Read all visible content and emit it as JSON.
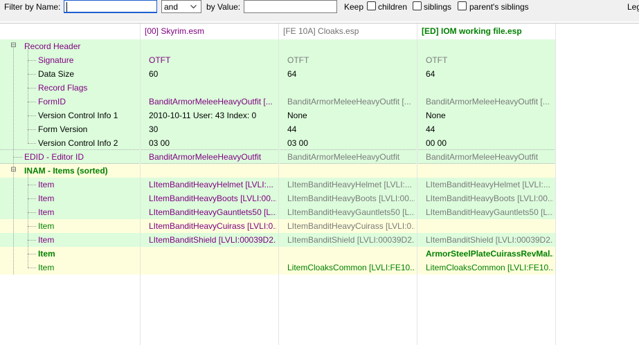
{
  "filter": {
    "by_name_label": "Filter by Name:",
    "name_value": "",
    "operator": "and",
    "by_value_label": "by Value:",
    "value_value": "",
    "keep_label": "Keep",
    "children_label": "children",
    "siblings_label": "siblings",
    "parents_siblings_label": "parent's siblings",
    "legend_partial": "Leg"
  },
  "columns": [
    "[00] Skyrim.esm",
    "[FE 10A] Cloaks.esp",
    "[ED] IOM working file.esp"
  ],
  "rows": [
    {
      "label": "Record Header",
      "values": [
        "",
        "",
        ""
      ]
    },
    {
      "label": "Signature",
      "values": [
        "OTFT",
        "OTFT",
        "OTFT"
      ]
    },
    {
      "label": "Data Size",
      "values": [
        "60",
        "64",
        "64"
      ]
    },
    {
      "label": "Record Flags",
      "values": [
        "",
        "",
        ""
      ]
    },
    {
      "label": "FormID",
      "values": [
        "BanditArmorMeleeHeavyOutfit [...",
        "BanditArmorMeleeHeavyOutfit [...",
        "BanditArmorMeleeHeavyOutfit [..."
      ]
    },
    {
      "label": "Version Control Info 1",
      "values": [
        "2010-10-11 User: 43 Index: 0",
        "None",
        "None"
      ]
    },
    {
      "label": "Form Version",
      "values": [
        "30",
        "44",
        "44"
      ]
    },
    {
      "label": "Version Control Info 2",
      "values": [
        "03 00",
        "03 00",
        "00 00"
      ]
    },
    {
      "label": "EDID - Editor ID",
      "values": [
        "BanditArmorMeleeHeavyOutfit",
        "BanditArmorMeleeHeavyOutfit",
        "BanditArmorMeleeHeavyOutfit"
      ]
    },
    {
      "label": "INAM - Items (sorted)",
      "values": [
        "",
        "",
        ""
      ]
    },
    {
      "label": "Item",
      "values": [
        "LItemBanditHeavyHelmet [LVLI:...",
        "LItemBanditHeavyHelmet [LVLI:...",
        "LItemBanditHeavyHelmet [LVLI:..."
      ]
    },
    {
      "label": "Item",
      "values": [
        "LItemBanditHeavyBoots [LVLI:00...",
        "LItemBanditHeavyBoots [LVLI:00...",
        "LItemBanditHeavyBoots [LVLI:00..."
      ]
    },
    {
      "label": "Item",
      "values": [
        "LItemBanditHeavyGauntlets50 [L...",
        "LItemBanditHeavyGauntlets50 [L...",
        "LItemBanditHeavyGauntlets50 [L..."
      ]
    },
    {
      "label": "Item",
      "values": [
        "LItemBanditHeavyCuirass [LVLI:0...",
        "LItemBanditHeavyCuirass [LVLI:0...",
        ""
      ]
    },
    {
      "label": "Item",
      "values": [
        "LItemBanditShield [LVLI:00039D2...",
        "LItemBanditShield [LVLI:00039D2...",
        "LItemBanditShield [LVLI:00039D2..."
      ]
    },
    {
      "label": "Item",
      "values": [
        "",
        "",
        "ArmorSteelPlateCuirassRevMal..."
      ]
    },
    {
      "label": "Item",
      "values": [
        "",
        "LitemCloaksCommon [LVLI:FE10...",
        "LitemCloaksCommon [LVLI:FE10..."
      ]
    }
  ]
}
